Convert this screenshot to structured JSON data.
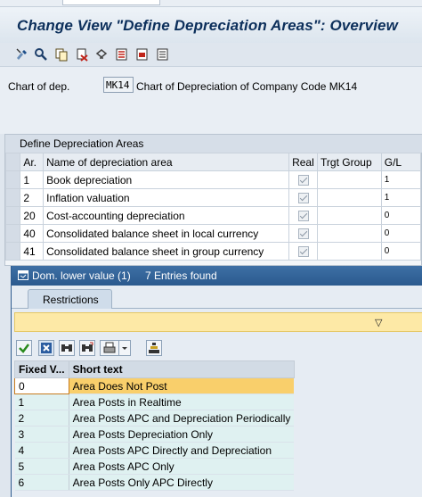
{
  "window": {
    "title": "Change View \"Define Depreciation Areas\": Overview"
  },
  "toolbar": {
    "icons": [
      "edit-icon",
      "details-icon",
      "copy-icon",
      "delete-icon",
      "undo-icon",
      "select-all-icon",
      "select-block-icon",
      "deselect-all-icon"
    ]
  },
  "header": {
    "chart_label": "Chart of dep.",
    "chart_value": "MK14",
    "chart_description": "Chart of Depreciation of Company Code MK14"
  },
  "grid": {
    "title": "Define Depreciation Areas",
    "columns": [
      "Ar.",
      "Name of depreciation area",
      "Real",
      "Trgt Group",
      "G/L"
    ],
    "rows": [
      {
        "ar": "1",
        "name": "Book depreciation",
        "real": true,
        "trgt": "",
        "gl": "1"
      },
      {
        "ar": "2",
        "name": "Inflation valuation",
        "real": true,
        "trgt": "",
        "gl": "1"
      },
      {
        "ar": "20",
        "name": "Cost-accounting depreciation",
        "real": true,
        "trgt": "",
        "gl": "0"
      },
      {
        "ar": "40",
        "name": "Consolidated balance sheet in local currency",
        "real": true,
        "trgt": "",
        "gl": "0"
      },
      {
        "ar": "41",
        "name": "Consolidated balance sheet in group currency",
        "real": true,
        "trgt": "",
        "gl": "0"
      }
    ]
  },
  "popup": {
    "title": "Dom. lower value (1)",
    "count_text": "7 Entries found",
    "tab_label": "Restrictions",
    "filter_icon": "filter-triangle-icon",
    "toolbar_icons": [
      "confirm-icon",
      "cancel-icon",
      "find-icon",
      "find-next-icon",
      "print-icon",
      "dropdown-icon",
      "sort-icon"
    ],
    "columns": [
      "Fixed V...",
      "Short text"
    ],
    "rows": [
      {
        "fixed": "0",
        "text": "Area Does Not Post"
      },
      {
        "fixed": "1",
        "text": "Area Posts in Realtime"
      },
      {
        "fixed": "2",
        "text": "Area Posts APC and Depreciation Periodically"
      },
      {
        "fixed": "3",
        "text": "Area Posts Depreciation Only"
      },
      {
        "fixed": "4",
        "text": "Area Posts APC Directly and Depreciation"
      },
      {
        "fixed": "5",
        "text": "Area Posts APC Only"
      },
      {
        "fixed": "6",
        "text": "Area Posts Only APC Directly"
      }
    ],
    "selected_index": 0
  },
  "colors": {
    "title_text": "#0c2f5b",
    "popup_titlebar": "#2b5a8e",
    "filter_bar": "#fde9a6",
    "highlight_row": "#f9cf6b",
    "result_cell": "#dff1f1"
  }
}
